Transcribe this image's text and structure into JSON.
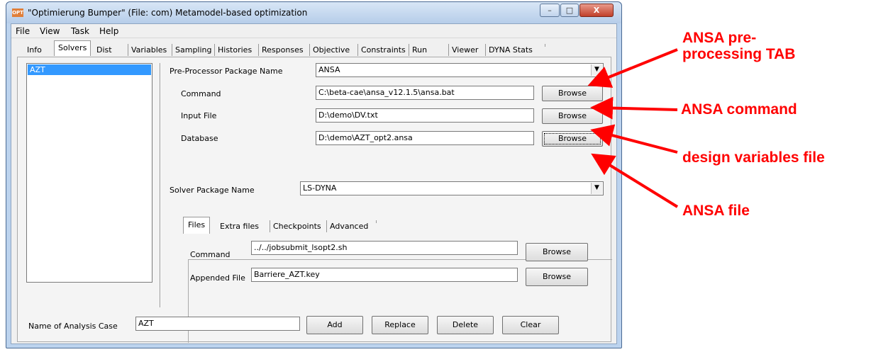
{
  "window": {
    "icon_text": "OPT",
    "title": "\"Optimierung Bumper\" (File: com)   Metamodel-based optimization",
    "controls": [
      "–",
      "□",
      "X"
    ]
  },
  "menubar": {
    "items": [
      "File",
      "View",
      "Task",
      "Help"
    ]
  },
  "tabs": [
    "Info",
    "Solvers",
    "Dist",
    "Variables",
    "Sampling",
    "Histories",
    "Responses",
    "Objective",
    "Constraints",
    "Run",
    "Viewer",
    "DYNA Stats"
  ],
  "active_tab": "Solvers",
  "case_list": {
    "items": [
      "AZT"
    ]
  },
  "preprocessor": {
    "package_label": "Pre-Processor Package Name",
    "package_value": "ANSA",
    "command_label": "Command",
    "command_value": "C:\\beta-cae\\ansa_v12.1.5\\ansa.bat",
    "input_label": "Input File",
    "input_value": "D:\\demo\\DV.txt",
    "database_label": "Database",
    "database_value": "D:\\demo\\AZT_opt2.ansa",
    "browse_label": "Browse"
  },
  "solver": {
    "package_label": "Solver Package Name",
    "package_value": "LS-DYNA",
    "tabs": [
      "Files",
      "Extra files",
      "Checkpoints",
      "Advanced"
    ],
    "active_tab": "Files",
    "command_label": "Command",
    "command_value": "../../jobsubmit_lsopt2.sh",
    "appended_label": "Appended File",
    "appended_value": "Barriere_AZT.key",
    "browse_label": "Browse"
  },
  "analysis_case": {
    "label": "Name of Analysis Case",
    "value": "AZT",
    "buttons": [
      "Add",
      "Replace",
      "Delete",
      "Clear"
    ]
  },
  "annotations": {
    "preprocessing_tab": "ANSA pre-\nprocessing TAB",
    "command": "ANSA command",
    "design_vars": "design variables file",
    "ansa_file": "ANSA file",
    "color": "#ff0000"
  }
}
